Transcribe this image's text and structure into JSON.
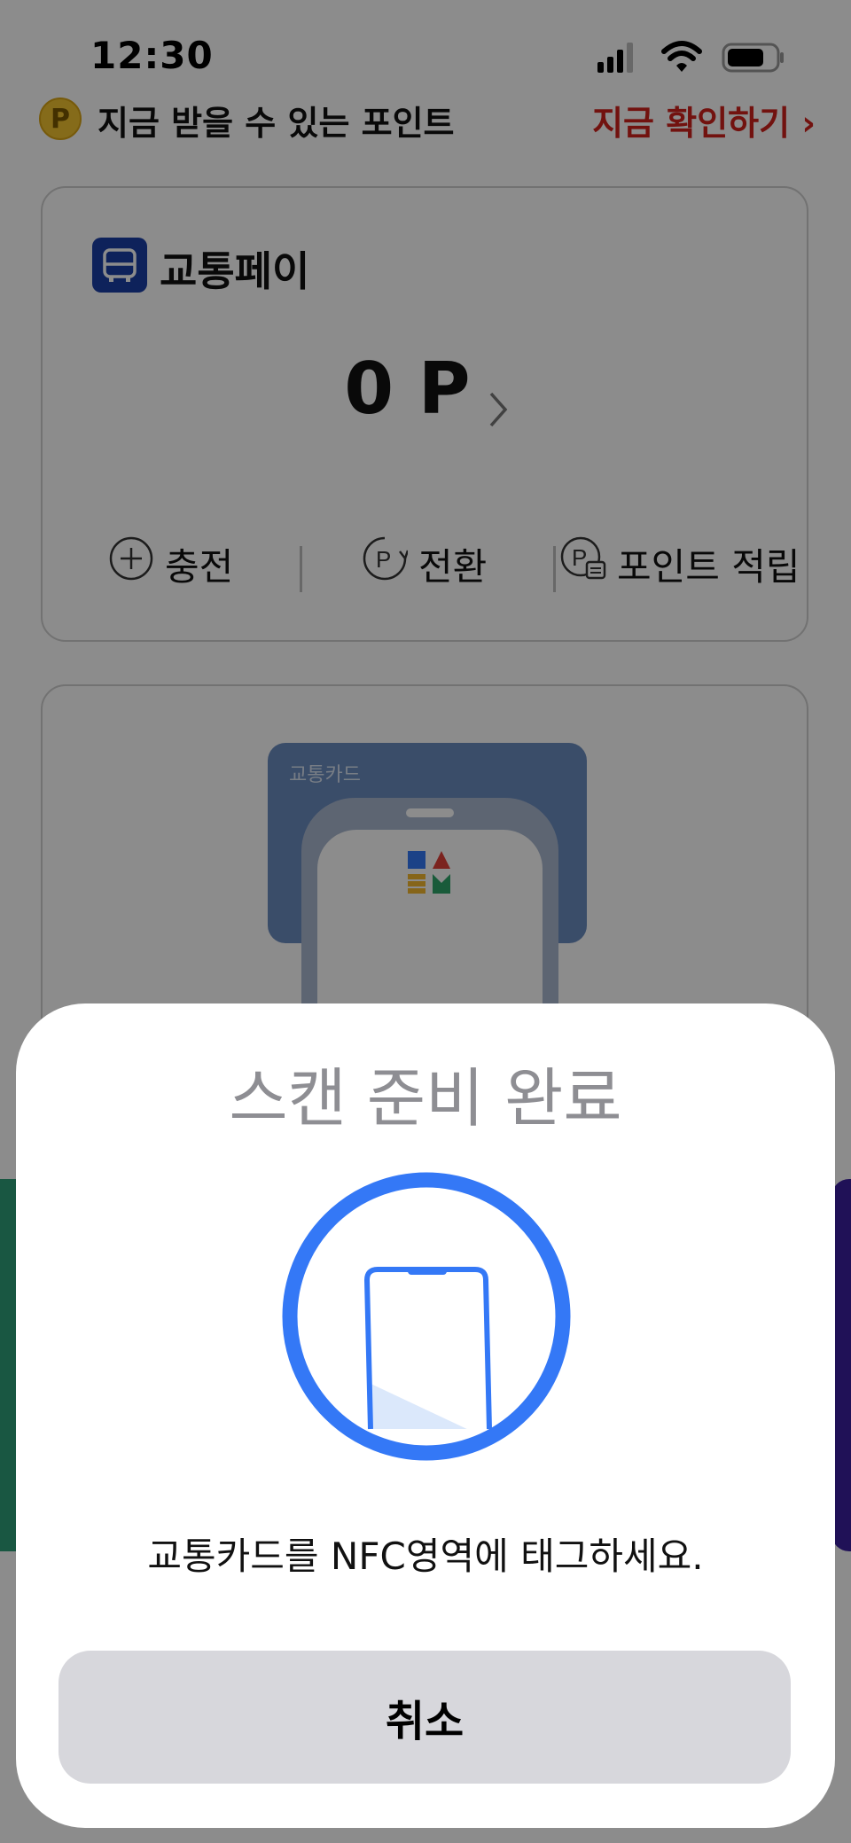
{
  "status_bar": {
    "time": "12:30"
  },
  "points_banner": {
    "coin_letter": "P",
    "text": "지금 받을 수 있는 포인트",
    "link": "지금 확인하기"
  },
  "transit_pay": {
    "title": "교통페이",
    "balance": "0 P",
    "actions": [
      {
        "label": "충전",
        "icon": "plus-circle-icon"
      },
      {
        "label": "전환",
        "icon": "point-convert-icon"
      },
      {
        "label": "포인트 적립",
        "icon": "point-earn-icon"
      }
    ]
  },
  "transit_card": {
    "label": "교통카드"
  },
  "nfc_sheet": {
    "title": "스캔 준비 완료",
    "message": "교통카드를 NFC영역에 태그하세요.",
    "cancel_label": "취소",
    "icon": "nfc-phone-icon"
  },
  "colors": {
    "accent_blue": "#3478f6",
    "link_red": "#d0221d",
    "card_icon_blue": "#1b3fa7"
  }
}
